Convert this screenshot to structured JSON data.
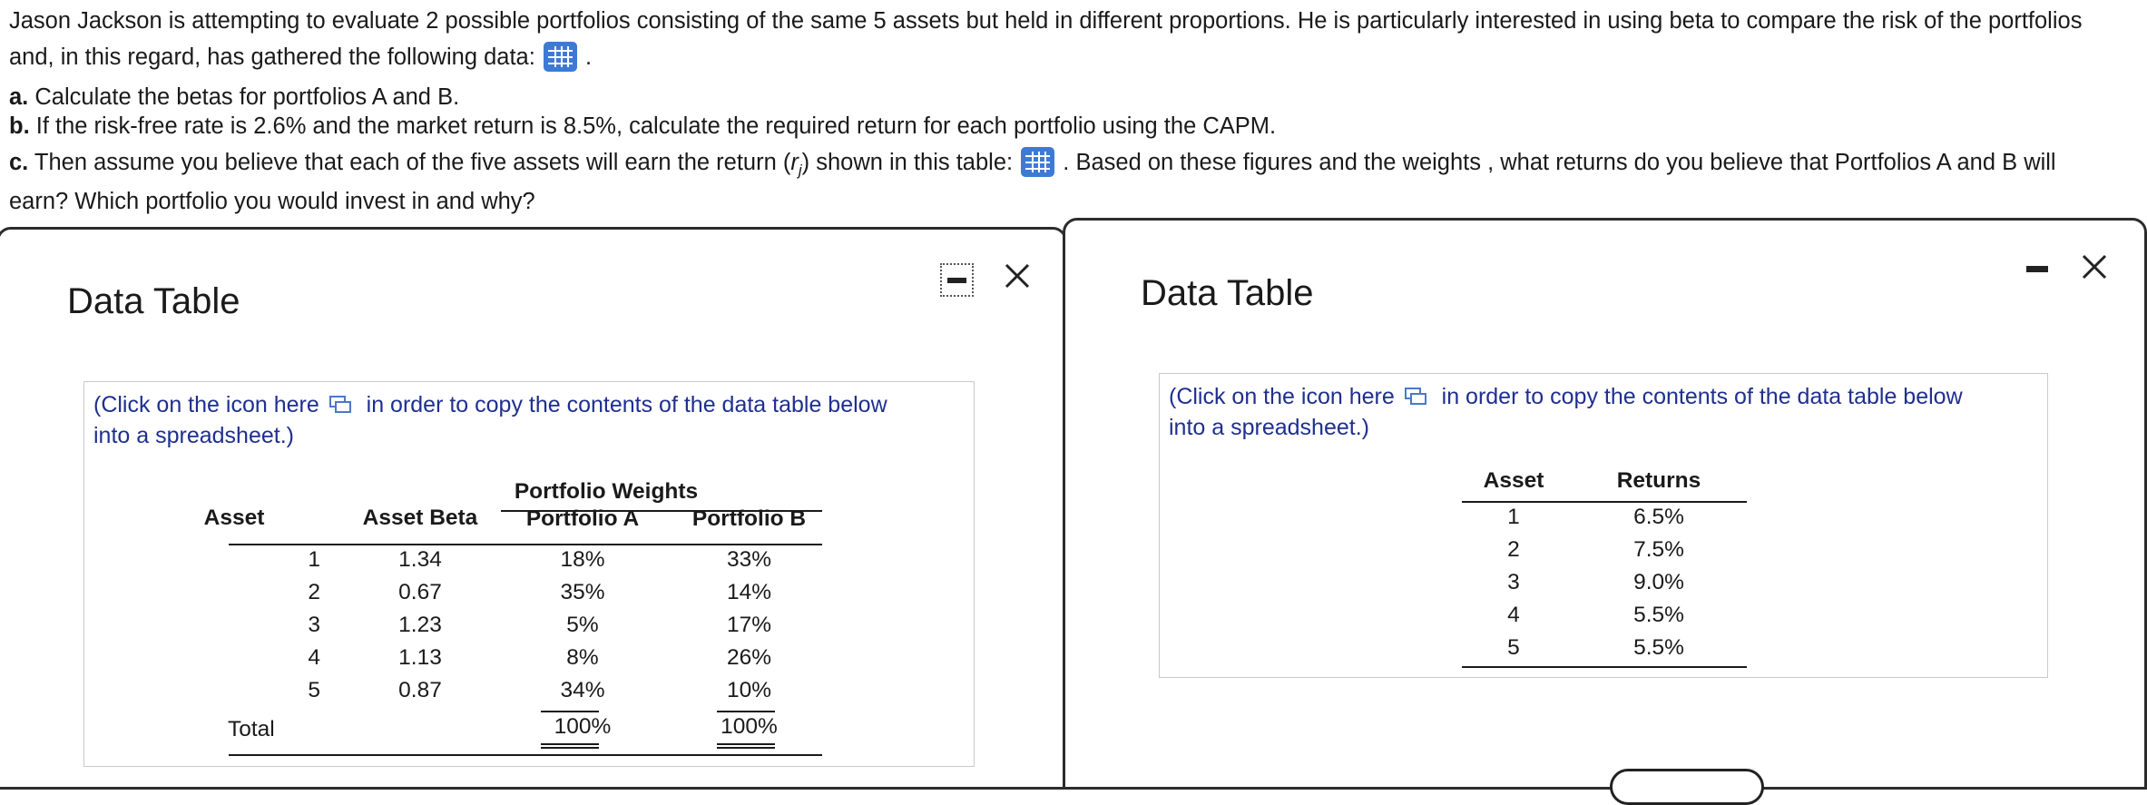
{
  "question": {
    "line1": "Jason Jackson is attempting to evaluate 2 possible portfolios consisting of the same 5 assets but held in different proportions.  He is particularly interested in using beta to compare the risk of the portfolios",
    "line2_text": "and, in this regard, has gathered the following data:",
    "line2_after": ".",
    "a_label": "a.",
    "a_text": "Calculate the betas for portfolios A and B.",
    "b_label": "b.",
    "b_text": "If the risk-free rate is 2.6% and the market return is 8.5%, calculate the required return for each portfolio using the CAPM.",
    "c_label": "c.",
    "c_text_before": "Then assume you believe that each of the five assets will earn the return (",
    "c_var": "r",
    "c_sub": "j",
    "c_text_mid": ") shown in this table:",
    "c_text_after": ". Based on  these figures and the weights , what returns do you believe that Portfolios A and B will",
    "c_line2": "earn? Which portfolio you would invest in and why?"
  },
  "left_panel": {
    "title": "Data Table",
    "hint_before": "(Click on the icon here",
    "hint_after": "in order to copy the contents of the data table below",
    "hint_line2": "into a spreadsheet.)",
    "group_header": "Portfolio Weights",
    "columns": [
      "Asset",
      "Asset Beta",
      "Portfolio A",
      "Portfolio B"
    ],
    "rows": [
      [
        "1",
        "1.34",
        "18%",
        "33%"
      ],
      [
        "2",
        "0.67",
        "35%",
        "14%"
      ],
      [
        "3",
        "1.23",
        "5%",
        "17%"
      ],
      [
        "4",
        "1.13",
        "8%",
        "26%"
      ],
      [
        "5",
        "0.87",
        "34%",
        "10%"
      ]
    ],
    "total_label": "Total",
    "total_a": "100%",
    "total_b": "100%"
  },
  "right_panel": {
    "title": "Data Table",
    "hint_before": "(Click on the icon here",
    "hint_after": "in order to copy the contents of the data table below",
    "hint_line2": "into a spreadsheet.)",
    "columns": [
      "Asset",
      "Returns"
    ],
    "rows": [
      [
        "1",
        "6.5%"
      ],
      [
        "2",
        "7.5%"
      ],
      [
        "3",
        "9.0%"
      ],
      [
        "4",
        "5.5%"
      ],
      [
        "5",
        "5.5%"
      ]
    ]
  },
  "icons": {
    "table_icon": "table-grid-icon",
    "copy_icon": "copy-icon",
    "minimize": "minimize-icon",
    "close": "close-icon",
    "accent": "#3d7ad6",
    "hint_color": "#1f2f8f"
  }
}
